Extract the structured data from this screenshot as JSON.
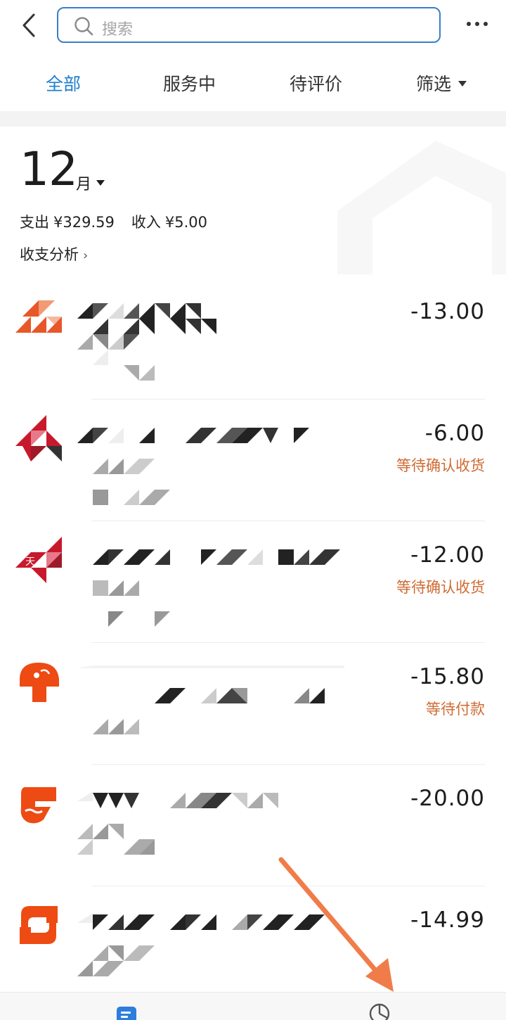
{
  "search": {
    "placeholder": "搜索"
  },
  "tabs": [
    {
      "label": "全部",
      "active": true
    },
    {
      "label": "服务中",
      "active": false
    },
    {
      "label": "待评价",
      "active": false
    },
    {
      "label": "筛选",
      "active": false
    }
  ],
  "month": {
    "number": "12",
    "unit": "月",
    "expense_label": "支出",
    "expense_value": "¥329.59",
    "income_label": "收入",
    "income_value": "¥5.00",
    "analysis_label": "收支分析",
    "analysis_arrow": "›"
  },
  "transactions": [
    {
      "amount": "-13.00",
      "status": "",
      "icon_color": "#e8572a"
    },
    {
      "amount": "-6.00",
      "status": "等待确认收货",
      "icon_color": "#c8192c"
    },
    {
      "amount": "-12.00",
      "status": "等待确认收货",
      "icon_color": "#c8192c"
    },
    {
      "amount": "-15.80",
      "status": "等待付款",
      "icon_color": "#ee4a13"
    },
    {
      "amount": "-20.00",
      "status": "",
      "icon_color": "#ee4a13"
    },
    {
      "amount": "-14.99",
      "status": "",
      "icon_color": "#ee4a13"
    }
  ],
  "colors": {
    "accent": "#1e7fd0",
    "status_orange": "#cf6b34",
    "annotation_arrow": "#f07c4a"
  },
  "icons": {
    "back": "chevron-left-icon",
    "search": "search-icon",
    "more": "more-dots-icon",
    "bottom_bill": "bill-list-icon",
    "bottom_chart": "pie-chart-icon"
  }
}
